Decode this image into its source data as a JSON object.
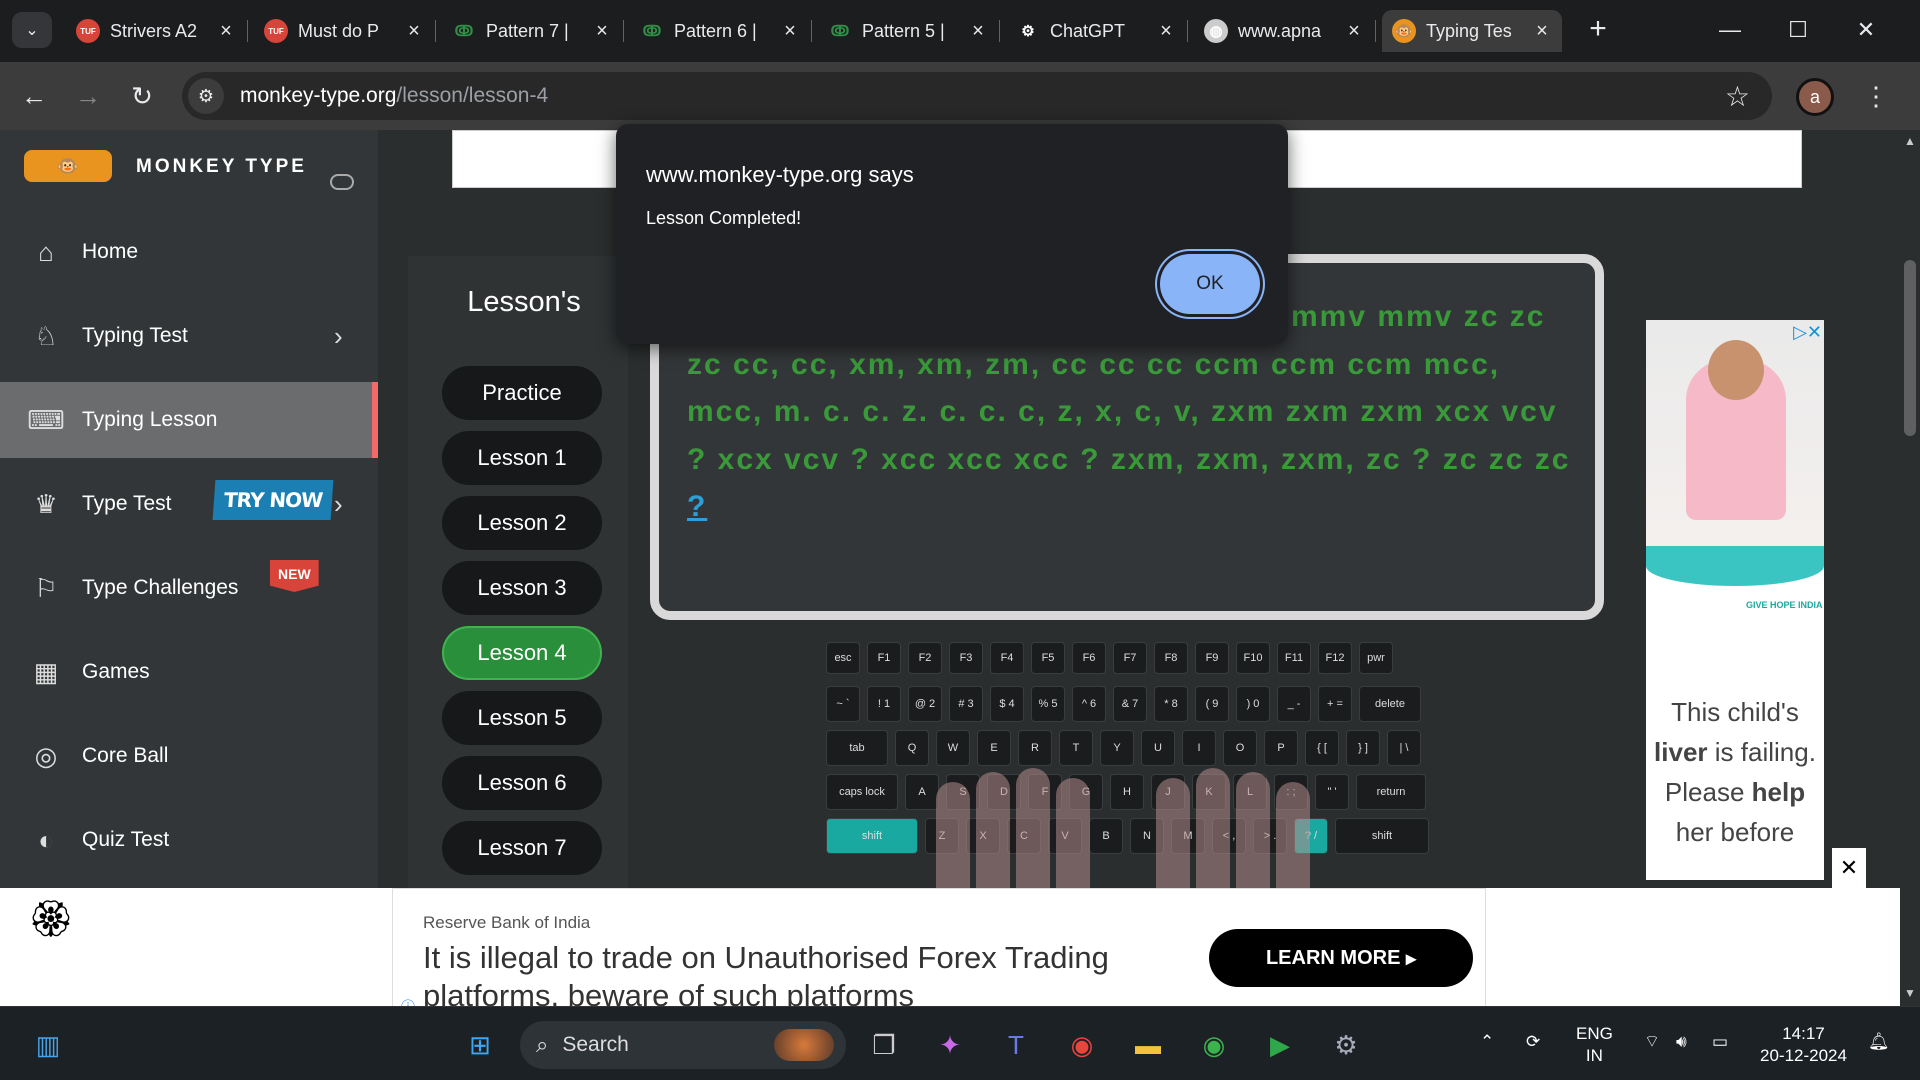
{
  "browser": {
    "tabs": [
      {
        "title": "Strivers A2",
        "icon": "tuf-icon",
        "active": false
      },
      {
        "title": "Must do P",
        "icon": "tuf-icon",
        "active": false
      },
      {
        "title": "Pattern 7 |",
        "icon": "gfg-icon",
        "active": false
      },
      {
        "title": "Pattern 6 |",
        "icon": "gfg-icon",
        "active": false
      },
      {
        "title": "Pattern 5 |",
        "icon": "gfg-icon",
        "active": false
      },
      {
        "title": "ChatGPT",
        "icon": "openai-icon",
        "active": false
      },
      {
        "title": "www.apna",
        "icon": "globe-icon",
        "active": false
      },
      {
        "title": "Typing Tes",
        "icon": "monkey-icon",
        "active": true
      }
    ],
    "url_domain": "monkey-type.org",
    "url_path": "/lesson/lesson-4",
    "profile_initial": "a"
  },
  "sidebar": {
    "brand": "MONKEY TYPE",
    "items": [
      {
        "label": "Home",
        "icon": "home-icon"
      },
      {
        "label": "Typing Test",
        "icon": "typing-test-icon"
      },
      {
        "label": "Typing Lesson",
        "icon": "keyboard-icon"
      },
      {
        "label": "Type Test",
        "icon": "crown-icon"
      },
      {
        "label": "Type Challenges",
        "icon": "award-icon"
      },
      {
        "label": "Games",
        "icon": "grid-icon"
      },
      {
        "label": "Core Ball",
        "icon": "target-icon"
      },
      {
        "label": "Quiz Test",
        "icon": "quiz-icon"
      }
    ],
    "try_now": "TRY NOW",
    "new_badge": "NEW"
  },
  "lessons": {
    "title": "Lesson's",
    "items": [
      "Practice",
      "Lesson 1",
      "Lesson 2",
      "Lesson 3",
      "Lesson 4",
      "Lesson 5",
      "Lesson 6",
      "Lesson 7"
    ],
    "active": "Lesson 4"
  },
  "typing": {
    "text": "c mmc xm xm xm xcm xcm xcm mmv mmv mmv zc zc zc cc, cc, xm, xm, zm, cc cc cc ccm ccm ccm mcc, mcc, m. c. c. z. c. c. c, z, x, c, v, zxm zxm zxm xcx vcv ? xcx vcv ? xcc xcc xcc ? zxm, zxm, zxm, zc ? zc zc zc ",
    "current_char": "?"
  },
  "keyboard": {
    "rows": [
      [
        "esc",
        "F1",
        "F2",
        "F3",
        "F4",
        "F5",
        "F6",
        "F7",
        "F8",
        "F9",
        "F10",
        "F11",
        "F12",
        "pwr"
      ],
      [
        "~ `",
        "! 1",
        "@ 2",
        "# 3",
        "$ 4",
        "% 5",
        "^ 6",
        "& 7",
        "* 8",
        "( 9",
        ") 0",
        "_ -",
        "+ =",
        "delete"
      ],
      [
        "tab",
        "Q",
        "W",
        "E",
        "R",
        "T",
        "Y",
        "U",
        "I",
        "O",
        "P",
        "{ [",
        "} ]",
        "| \\"
      ],
      [
        "caps lock",
        "A",
        "S",
        "D",
        "F",
        "G",
        "H",
        "J",
        "K",
        "L",
        ": ;",
        "\" '",
        "return"
      ],
      [
        "shift",
        "Z",
        "X",
        "C",
        "V",
        "B",
        "N",
        "M",
        "< ,",
        "> .",
        "? /",
        "shift"
      ]
    ]
  },
  "dialog": {
    "title": "www.monkey-type.org says",
    "message": "Lesson Completed!",
    "ok": "OK"
  },
  "side_ad": {
    "message_html_parts": [
      "This child's",
      "liver",
      " is failing. Please ",
      "help",
      " her before"
    ],
    "org": "GIVE HOPE INDIA"
  },
  "bottom_ad": {
    "source": "Reserve Bank of India",
    "headline": "It is illegal to trade on Unauthorised Forex Trading platforms, beware of such platforms",
    "cta": "LEARN MORE"
  },
  "taskbar": {
    "search": "Search",
    "lang_top": "ENG",
    "lang_bottom": "IN",
    "time": "14:17",
    "date": "20-12-2024"
  },
  "colors": {
    "accent_green": "#3a9a3a",
    "active_lesson": "#2a8f3a",
    "sidebar_active_border": "#f26a6a"
  }
}
